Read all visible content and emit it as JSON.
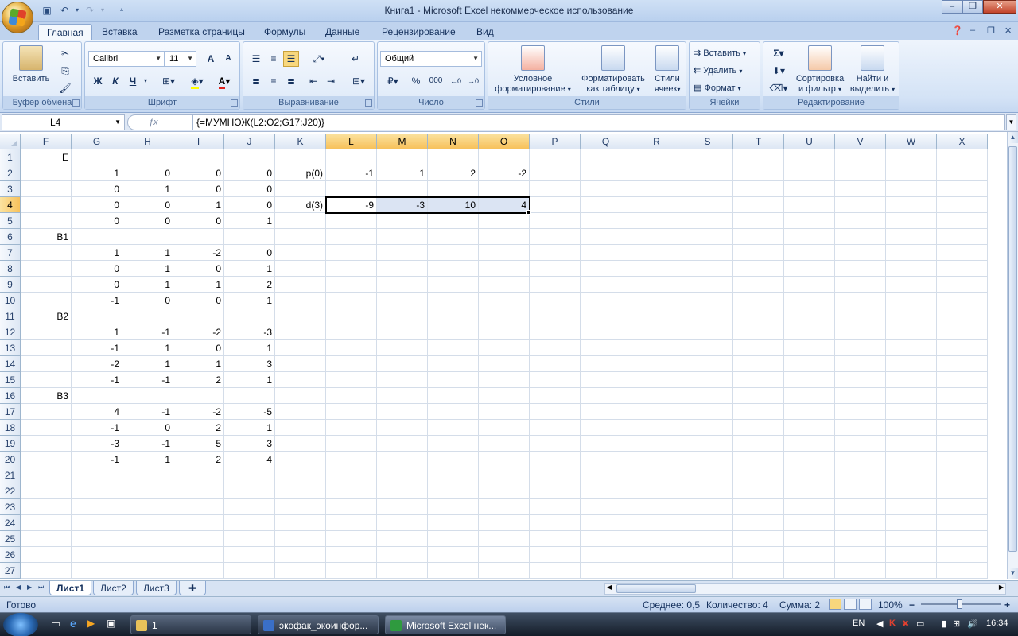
{
  "window": {
    "title": "Книга1 - Microsoft Excel некоммерческое использование",
    "minimize": "‒",
    "maximize": "❐",
    "close": "✕"
  },
  "tabs": [
    {
      "label": "Главная"
    },
    {
      "label": "Вставка"
    },
    {
      "label": "Разметка страницы"
    },
    {
      "label": "Формулы"
    },
    {
      "label": "Данные"
    },
    {
      "label": "Рецензирование"
    },
    {
      "label": "Вид"
    }
  ],
  "ribbon": {
    "clipboard": {
      "label": "Буфер обмена",
      "paste": "Вставить"
    },
    "font": {
      "label": "Шрифт",
      "name": "Calibri",
      "size": "11",
      "bold": "Ж",
      "italic": "К",
      "underline": "Ч",
      "grow": "A",
      "shrink": "A",
      "color_letter": "A"
    },
    "alignment": {
      "label": "Выравнивание"
    },
    "number": {
      "label": "Число",
      "format": "Общий",
      "percent": "%",
      "thousands": "000"
    },
    "styles": {
      "label": "Стили",
      "cond_format": [
        "Условное",
        "форматирование"
      ],
      "as_table": [
        "Форматировать",
        "как таблицу"
      ],
      "cell_styles": [
        "Стили",
        "ячеек"
      ]
    },
    "cells": {
      "label": "Ячейки",
      "insert": "Вставить",
      "delete": "Удалить",
      "format": "Формат"
    },
    "editing": {
      "label": "Редактирование",
      "sort": [
        "Сортировка",
        "и фильтр"
      ],
      "find": [
        "Найти и",
        "выделить"
      ]
    }
  },
  "formula_bar": {
    "name_box": "L4",
    "formula": "{=МУМНОЖ(L2:O2;G17:J20)}"
  },
  "grid": {
    "columns": [
      "F",
      "G",
      "H",
      "I",
      "J",
      "K",
      "L",
      "M",
      "N",
      "O",
      "P",
      "Q",
      "R",
      "S",
      "T",
      "U",
      "V",
      "W",
      "X"
    ],
    "rows": [
      "1",
      "2",
      "3",
      "4",
      "5",
      "6",
      "7",
      "8",
      "9",
      "10",
      "11",
      "12",
      "13",
      "14",
      "15",
      "16",
      "17",
      "18",
      "19",
      "20",
      "21",
      "22",
      "23",
      "24",
      "25",
      "26",
      "27"
    ],
    "cells": [
      [
        "E",
        "",
        "",
        "",
        "",
        "",
        "",
        "",
        "",
        ""
      ],
      [
        "",
        "1",
        "0",
        "0",
        "0",
        "p(0)",
        "-1",
        "1",
        "2",
        "-2"
      ],
      [
        "",
        "0",
        "1",
        "0",
        "0",
        "",
        "",
        "",
        "",
        ""
      ],
      [
        "",
        "0",
        "0",
        "1",
        "0",
        "d(3)",
        "-9",
        "-3",
        "10",
        "4"
      ],
      [
        "",
        "0",
        "0",
        "0",
        "1",
        "",
        "",
        "",
        "",
        ""
      ],
      [
        "B1",
        "",
        "",
        "",
        "",
        "",
        "",
        "",
        "",
        ""
      ],
      [
        "",
        "1",
        "1",
        "-2",
        "0",
        "",
        "",
        "",
        "",
        ""
      ],
      [
        "",
        "0",
        "1",
        "0",
        "1",
        "",
        "",
        "",
        "",
        ""
      ],
      [
        "",
        "0",
        "1",
        "1",
        "2",
        "",
        "",
        "",
        "",
        ""
      ],
      [
        "",
        "-1",
        "0",
        "0",
        "1",
        "",
        "",
        "",
        "",
        ""
      ],
      [
        "B2",
        "",
        "",
        "",
        "",
        "",
        "",
        "",
        "",
        ""
      ],
      [
        "",
        "1",
        "-1",
        "-2",
        "-3",
        "",
        "",
        "",
        "",
        ""
      ],
      [
        "",
        "-1",
        "1",
        "0",
        "1",
        "",
        "",
        "",
        "",
        ""
      ],
      [
        "",
        "-2",
        "1",
        "1",
        "3",
        "",
        "",
        "",
        "",
        ""
      ],
      [
        "",
        "-1",
        "-1",
        "2",
        "1",
        "",
        "",
        "",
        "",
        ""
      ],
      [
        "B3",
        "",
        "",
        "",
        "",
        "",
        "",
        "",
        "",
        ""
      ],
      [
        "",
        "4",
        "-1",
        "-2",
        "-5",
        "",
        "",
        "",
        "",
        ""
      ],
      [
        "",
        "-1",
        "0",
        "2",
        "1",
        "",
        "",
        "",
        "",
        ""
      ],
      [
        "",
        "-3",
        "-1",
        "5",
        "3",
        "",
        "",
        "",
        "",
        ""
      ],
      [
        "",
        "-1",
        "1",
        "2",
        "4",
        "",
        "",
        "",
        "",
        ""
      ]
    ]
  },
  "sheets": [
    {
      "label": "Лист1"
    },
    {
      "label": "Лист2"
    },
    {
      "label": "Лист3"
    }
  ],
  "status": {
    "ready": "Готово",
    "average": "Среднее: 0,5",
    "count": "Количество: 4",
    "sum": "Сумма: 2",
    "zoom": "100%",
    "zoom_minus": "−",
    "zoom_plus": "+"
  },
  "taskbar": {
    "items": [
      {
        "label": "1"
      },
      {
        "label": "экофак_экоинфор..."
      },
      {
        "label": "Microsoft Excel нек..."
      }
    ],
    "lang": "EN",
    "time": "16:34"
  }
}
